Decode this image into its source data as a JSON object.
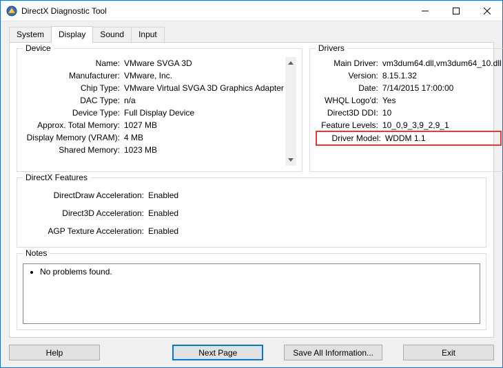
{
  "window": {
    "title": "DirectX Diagnostic Tool"
  },
  "tabs": {
    "system": "System",
    "display": "Display",
    "sound": "Sound",
    "input": "Input",
    "selected": "display"
  },
  "groups": {
    "device": "Device",
    "drivers": "Drivers",
    "dxfeatures": "DirectX Features",
    "notes": "Notes"
  },
  "device": {
    "labels": {
      "name": "Name:",
      "manufacturer": "Manufacturer:",
      "chip_type": "Chip Type:",
      "dac_type": "DAC Type:",
      "device_type": "Device Type:",
      "approx_total_memory": "Approx. Total Memory:",
      "display_memory": "Display Memory (VRAM):",
      "shared_memory": "Shared Memory:"
    },
    "values": {
      "name": "VMware SVGA 3D",
      "manufacturer": "VMware, Inc.",
      "chip_type": "VMware Virtual SVGA 3D Graphics Adapter",
      "dac_type": "n/a",
      "device_type": "Full Display Device",
      "approx_total_memory": "1027 MB",
      "display_memory": "4 MB",
      "shared_memory": "1023 MB"
    }
  },
  "drivers": {
    "labels": {
      "main_driver": "Main Driver:",
      "version": "Version:",
      "date": "Date:",
      "whql": "WHQL Logo'd:",
      "d3d_ddi": "Direct3D DDI:",
      "feature_levels": "Feature Levels:",
      "driver_model": "Driver Model:"
    },
    "values": {
      "main_driver": "vm3dum64.dll,vm3dum64_10.dll",
      "version": "8.15.1.32",
      "date": "7/14/2015 17:00:00",
      "whql": "Yes",
      "d3d_ddi": "10",
      "feature_levels": "10_0,9_3,9_2,9_1",
      "driver_model": "WDDM 1.1"
    }
  },
  "dxfeatures": {
    "labels": {
      "directdraw": "DirectDraw Acceleration:",
      "direct3d": "Direct3D Acceleration:",
      "agp": "AGP Texture Acceleration:"
    },
    "values": {
      "directdraw": "Enabled",
      "direct3d": "Enabled",
      "agp": "Enabled"
    }
  },
  "notes": {
    "item0": "No problems found."
  },
  "buttons": {
    "help": "Help",
    "next_page": "Next Page",
    "save_all": "Save All Information...",
    "exit": "Exit"
  }
}
